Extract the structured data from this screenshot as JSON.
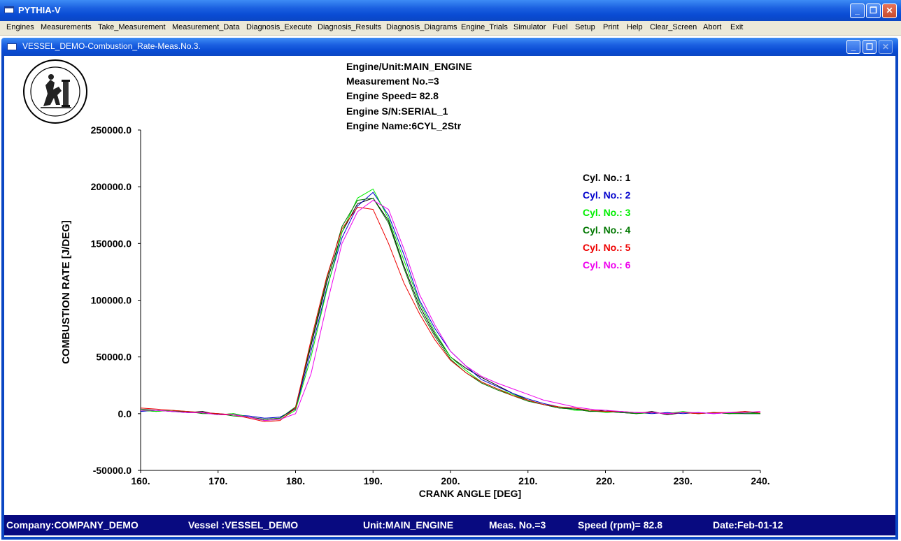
{
  "window": {
    "app_title": "PYTHIA-V",
    "child_title": "VESSEL_DEMO-Combustion_Rate-Meas.No.3."
  },
  "menu": [
    "Engines",
    "Measurements",
    "Take_Measurement",
    "Measurement_Data",
    "Diagnosis_Execute",
    "Diagnosis_Results",
    "Diagnosis_Diagrams",
    "Engine_Trials",
    "Simulator",
    "Fuel",
    "Setup",
    "Print",
    "Help",
    "Clear_Screen",
    "Abort",
    "Exit"
  ],
  "header": {
    "engine_unit": "Engine/Unit:MAIN_ENGINE",
    "measurement_no": "Measurement No.=3",
    "engine_speed": "Engine Speed=  82.8",
    "engine_sn": "Engine S/N:SERIAL_1",
    "engine_name": "Engine Name:6CYL_2Str"
  },
  "statusbar": {
    "company": "Company:COMPANY_DEMO",
    "vessel": "Vessel :VESSEL_DEMO",
    "unit": "Unit:MAIN_ENGINE",
    "meas": "Meas. No.=3",
    "speed": "Speed (rpm)=  82.8",
    "date": "Date:Feb-01-12"
  },
  "icons": [
    "app-window-icon",
    "minimize-icon",
    "maximize-icon",
    "restore-icon",
    "close-icon",
    "university-seal-logo"
  ],
  "chart_data": {
    "type": "line",
    "xlabel": "CRANK ANGLE [DEG]",
    "ylabel": "COMBUSTION RATE [J/DEG]",
    "xlim": [
      160,
      240
    ],
    "ylim": [
      -50000,
      250000
    ],
    "xticks": [
      "160.",
      "170.",
      "180.",
      "190.",
      "200.",
      "210.",
      "220.",
      "230.",
      "240."
    ],
    "yticks": [
      "250000.0",
      "200000.0",
      "150000.0",
      "100000.0",
      "50000.0",
      "0.0",
      "-50000.0"
    ],
    "legend_position": "top-right",
    "x": [
      160,
      162,
      164,
      166,
      168,
      170,
      172,
      174,
      176,
      178,
      180,
      182,
      184,
      186,
      188,
      190,
      192,
      194,
      196,
      198,
      200,
      202,
      204,
      206,
      208,
      210,
      212,
      214,
      216,
      218,
      220,
      222,
      224,
      226,
      228,
      230,
      232,
      234,
      236,
      238,
      240
    ],
    "series": [
      {
        "name": "Cyl. No.: 1",
        "color": "#000000",
        "values": [
          3000,
          2000,
          3000,
          1000,
          2000,
          -1000,
          0,
          -3000,
          -5000,
          -4000,
          5000,
          60000,
          115000,
          160000,
          185000,
          190000,
          170000,
          130000,
          95000,
          70000,
          50000,
          40000,
          32000,
          25000,
          18000,
          12000,
          8000,
          5000,
          4000,
          2000,
          3000,
          1000,
          0,
          2000,
          -1000,
          1000,
          0,
          1000,
          0,
          2000,
          0
        ]
      },
      {
        "name": "Cyl. No.: 2",
        "color": "#0000cc",
        "values": [
          2000,
          3000,
          2000,
          1000,
          1000,
          0,
          -1000,
          -2000,
          -4000,
          -3000,
          4000,
          55000,
          110000,
          155000,
          183000,
          195000,
          175000,
          140000,
          100000,
          75000,
          55000,
          42000,
          30000,
          24000,
          18000,
          13000,
          9000,
          6000,
          4000,
          3000,
          2000,
          1000,
          1000,
          0,
          1000,
          0,
          1000,
          0,
          1000,
          0,
          0
        ]
      },
      {
        "name": "Cyl. No.: 3",
        "color": "#00ee00",
        "values": [
          3000,
          2000,
          3000,
          2000,
          1000,
          -1000,
          0,
          -3000,
          -6000,
          -5000,
          3000,
          50000,
          108000,
          160000,
          190000,
          198000,
          172000,
          135000,
          98000,
          72000,
          50000,
          38000,
          28000,
          22000,
          17000,
          12000,
          8000,
          6000,
          3000,
          3000,
          1000,
          2000,
          0,
          1000,
          0,
          2000,
          0,
          1000,
          0,
          1000,
          0
        ]
      },
      {
        "name": "Cyl. No.: 4",
        "color": "#007700",
        "values": [
          4000,
          3000,
          2000,
          2000,
          0,
          0,
          -2000,
          -3000,
          -5000,
          -4000,
          6000,
          62000,
          118000,
          165000,
          188000,
          190000,
          168000,
          128000,
          92000,
          68000,
          48000,
          36000,
          27000,
          21000,
          16000,
          11000,
          8000,
          5000,
          4000,
          2000,
          2000,
          1000,
          0,
          1000,
          0,
          1000,
          0,
          1000,
          0,
          0,
          0
        ]
      },
      {
        "name": "Cyl. No.: 5",
        "color": "#ee0000",
        "values": [
          5000,
          4000,
          3000,
          2000,
          1000,
          0,
          -1000,
          -4000,
          -7000,
          -6000,
          5000,
          65000,
          120000,
          163000,
          182000,
          180000,
          150000,
          115000,
          88000,
          65000,
          47000,
          36000,
          28000,
          22000,
          16000,
          12000,
          8000,
          6000,
          5000,
          3000,
          2000,
          2000,
          1000,
          1000,
          0,
          1000,
          0,
          1000,
          1000,
          2000,
          1000
        ]
      },
      {
        "name": "Cyl. No.: 6",
        "color": "#ee00ee",
        "values": [
          3000,
          3000,
          2000,
          1000,
          1000,
          -1000,
          -1000,
          -3000,
          -6000,
          -5000,
          0,
          35000,
          95000,
          150000,
          178000,
          188000,
          180000,
          145000,
          105000,
          78000,
          55000,
          42000,
          33000,
          27000,
          22000,
          17000,
          12000,
          9000,
          6000,
          4000,
          3000,
          2000,
          1000,
          1000,
          0,
          1000,
          1000,
          0,
          1000,
          1000,
          2000
        ]
      }
    ]
  }
}
